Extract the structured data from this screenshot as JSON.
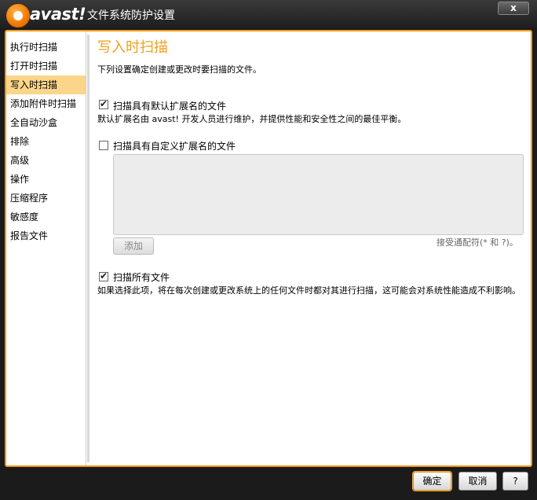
{
  "window": {
    "brand": "avast!",
    "title": "文件系统防护设置",
    "close_label": "x"
  },
  "sidebar": {
    "items": [
      {
        "label": "执行时扫描"
      },
      {
        "label": "打开时扫描"
      },
      {
        "label": "写入时扫描",
        "active": true
      },
      {
        "label": "添加附件时扫描"
      },
      {
        "label": "全自动沙盒"
      },
      {
        "label": "排除"
      },
      {
        "label": "高级"
      },
      {
        "label": "操作"
      },
      {
        "label": "压缩程序"
      },
      {
        "label": "敏感度"
      },
      {
        "label": "报告文件"
      }
    ]
  },
  "main": {
    "title": "写入时扫描",
    "description": "下列设置确定创建或更改时要扫描的文件。",
    "opt_default_ext": {
      "label": "扫描具有默认扩展名的文件",
      "checked": true,
      "description": "默认扩展名由 avast! 开发人员进行维护，并提供性能和安全性之间的最佳平衡。"
    },
    "opt_custom_ext": {
      "label": "扫描具有自定义扩展名的文件",
      "checked": false,
      "add_label": "添加",
      "hint": "接受通配符(* 和 ?)。"
    },
    "opt_all_files": {
      "label": "扫描所有文件",
      "checked": true,
      "description": "如果选择此项，将在每次创建或更改系统上的任何文件时都对其进行扫描，这可能会对系统性能造成不利影响。"
    }
  },
  "footer": {
    "ok_label": "确定",
    "cancel_label": "取消",
    "help_label": "?"
  },
  "colors": {
    "accent": "#f29a1e",
    "active_item": "#fbd589",
    "title_text": "#f0a020"
  }
}
